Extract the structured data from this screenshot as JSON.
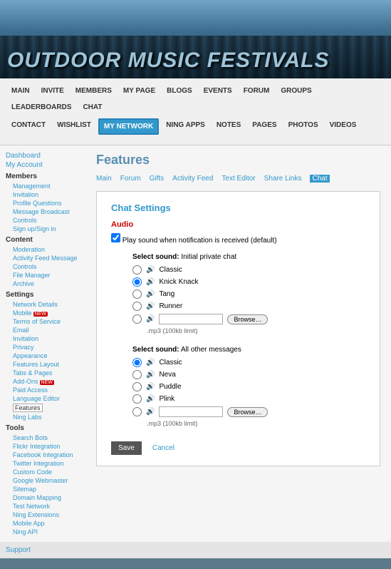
{
  "site_title": "OUTDOOR MUSIC FESTIVALS",
  "nav_row1": [
    "MAIN",
    "INVITE",
    "MEMBERS",
    "MY PAGE",
    "BLOGS",
    "EVENTS",
    "FORUM",
    "GROUPS",
    "LEADERBOARDS",
    "CHAT"
  ],
  "nav_row2": [
    "CONTACT",
    "WISHLIST",
    "MY NETWORK",
    "NING APPS",
    "NOTES",
    "PAGES",
    "PHOTOS",
    "VIDEOS"
  ],
  "nav_active": "MY NETWORK",
  "sidebar": {
    "top": [
      "Dashboard",
      "My Account"
    ],
    "members": {
      "title": "Members",
      "items": [
        "Management",
        "Invitation",
        "Profile Questions",
        "Message Broadcast",
        "Controls",
        "Sign up/Sign in"
      ]
    },
    "content": {
      "title": "Content",
      "items": [
        "Moderation",
        "Activity Feed Message",
        "Controls",
        "File Manager",
        "Archive"
      ]
    },
    "settings": {
      "title": "Settings",
      "items": [
        {
          "label": "Network Details"
        },
        {
          "label": "Mobile",
          "badge": "NEW"
        },
        {
          "label": "Terms of Service"
        },
        {
          "label": "Email"
        },
        {
          "label": "Invitation"
        },
        {
          "label": "Privacy"
        },
        {
          "label": "Appearance"
        },
        {
          "label": "Features Layout"
        },
        {
          "label": "Tabs & Pages"
        },
        {
          "label": "Add-Ons",
          "badge": "NEW"
        },
        {
          "label": "Paid Access"
        },
        {
          "label": "Language Editor"
        },
        {
          "label": "Features",
          "boxed": true
        },
        {
          "label": "Ning Labs"
        }
      ]
    },
    "tools": {
      "title": "Tools",
      "items": [
        "Search Bots",
        "Flickr Integration",
        "Facebook Integration",
        "Twitter Integration",
        "Custom Code",
        "Google Webmaster",
        "Sitemap",
        "Domain Mapping",
        "Test Network",
        "Ning Extensions",
        "Mobile App",
        "Ning API"
      ]
    },
    "support": "Support"
  },
  "page_title": "Features",
  "tabs": [
    "Main",
    "Forum",
    "Gifts",
    "Activity Feed",
    "Text Editor",
    "Share Links",
    "Chat"
  ],
  "active_tab": "Chat",
  "panel": {
    "title": "Chat Settings",
    "audio_title": "Audio",
    "play_sound_label": "Play sound when notification is received (default)",
    "group1": {
      "label_prefix": "Select sound:",
      "label_suffix": "Initial private chat",
      "options": [
        "Classic",
        "Knick Knack",
        "Tang",
        "Runner"
      ],
      "browse": "Browse…",
      "hint": ".mp3 (100kb limit)"
    },
    "group2": {
      "label_prefix": "Select sound:",
      "label_suffix": "All other messages",
      "options": [
        "Classic",
        "Neva",
        "Puddle",
        "Plink"
      ],
      "browse": "Browse…",
      "hint": ".mp3 (100kb limit)"
    },
    "save": "Save",
    "cancel": "Cancel"
  }
}
